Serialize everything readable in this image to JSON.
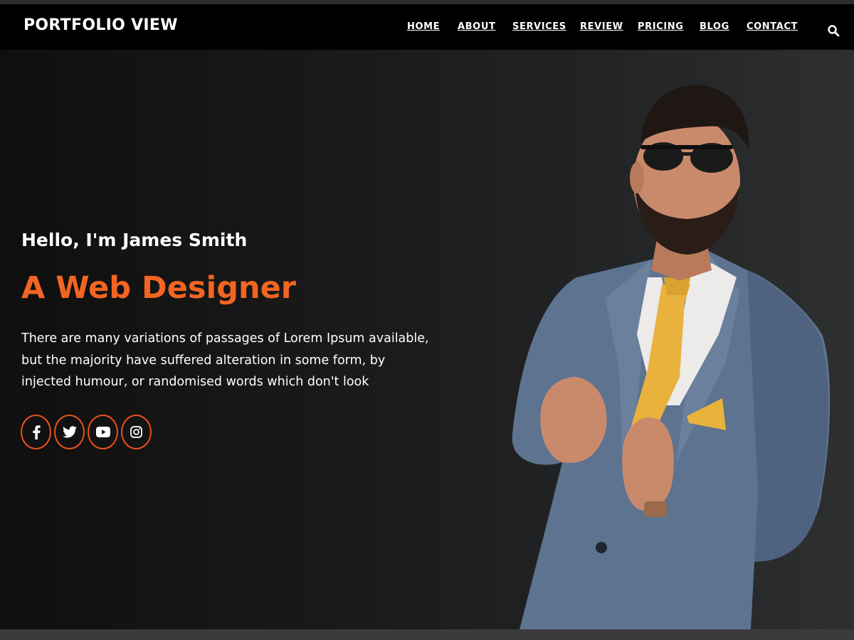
{
  "header": {
    "brand": "PORTFOLIO VIEW",
    "nav": {
      "home": "HOME",
      "about": "ABOUT",
      "services": "SERVICES",
      "review": "REVIEW",
      "pricing": "PRICING",
      "blog": "BLOG",
      "contact": "CONTACT"
    },
    "search_icon": "search-icon"
  },
  "hero": {
    "greeting": "Hello, I'm James Smith",
    "role": "A Web Designer",
    "description": "There are many variations of passages of Lorem Ipsum available, but the majority have suffered alteration in some form, by injected humour, or randomised words which don't look",
    "social": [
      {
        "icon": "facebook-icon"
      },
      {
        "icon": "twitter-icon"
      },
      {
        "icon": "youtube-icon"
      },
      {
        "icon": "instagram-icon"
      }
    ]
  },
  "colors": {
    "accent": "#f26522",
    "navbar_bg": "#000000",
    "hero_bg_dark": "#0f0f10",
    "hero_bg_light": "#2e2f30"
  }
}
